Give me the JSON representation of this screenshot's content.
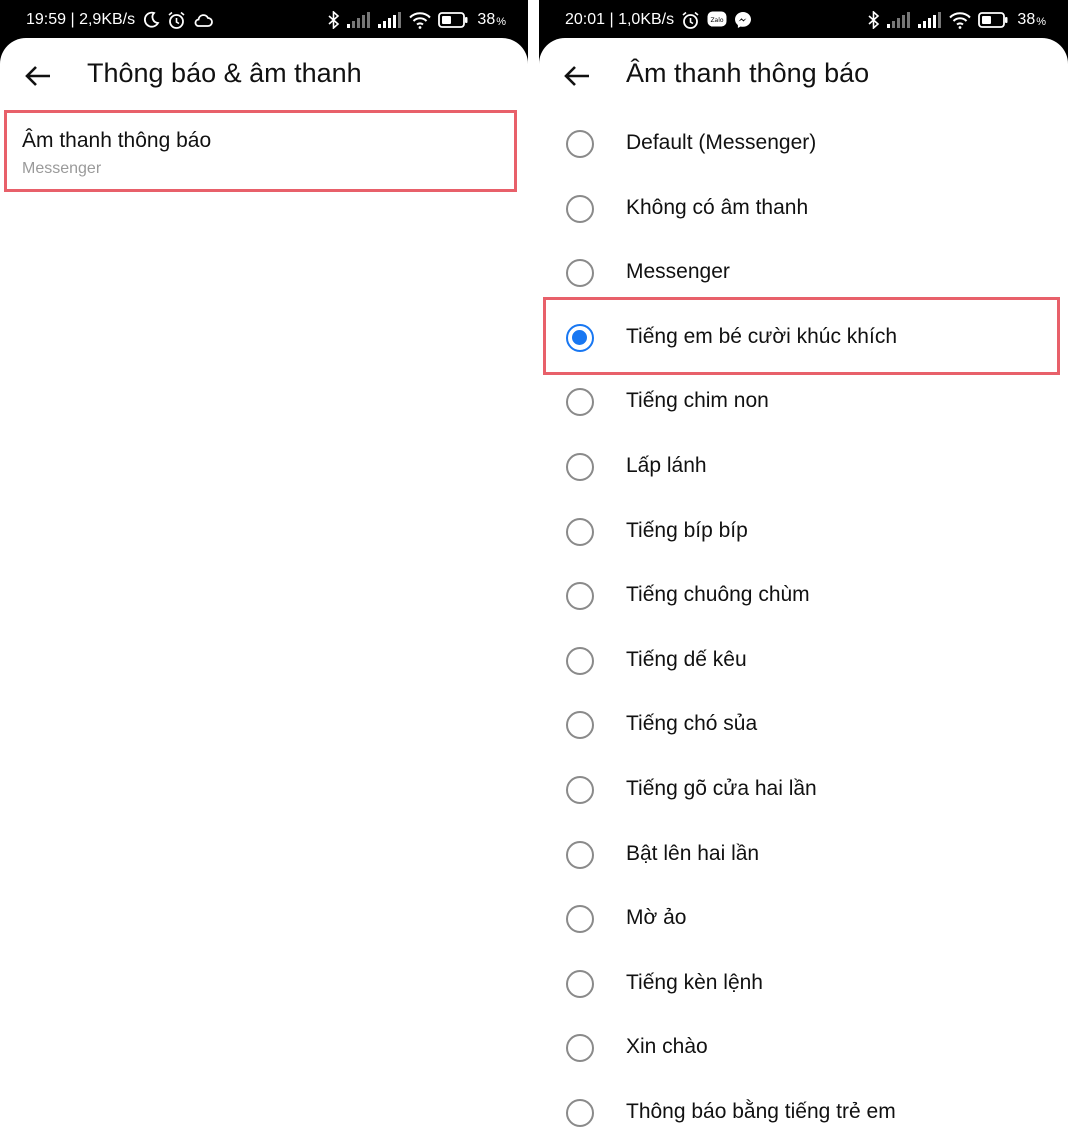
{
  "colors": {
    "accent": "#1877f2",
    "highlight": "#e8606a",
    "subtext": "#9a9a9a"
  },
  "left": {
    "status": {
      "time_speed": "19:59 | 2,9KB/s",
      "battery": "38"
    },
    "title": "Thông báo & âm thanh",
    "setting": {
      "title": "Âm thanh thông báo",
      "subtitle": "Messenger"
    }
  },
  "right": {
    "status": {
      "time_speed": "20:01 | 1,0KB/s",
      "battery": "38",
      "zalo_label": "Zalo"
    },
    "title": "Âm thanh thông báo",
    "selected_index": 3,
    "options": [
      "Default (Messenger)",
      "Không có âm thanh",
      "Messenger",
      "Tiếng em bé cười khúc khích",
      "Tiếng chim non",
      "Lấp lánh",
      "Tiếng bíp bíp",
      "Tiếng chuông chùm",
      "Tiếng dế kêu",
      "Tiếng chó sủa",
      "Tiếng gõ cửa hai lần",
      "Bật lên hai lần",
      "Mờ ảo",
      "Tiếng kèn lệnh",
      "Xin chào",
      "Thông báo bằng tiếng trẻ em"
    ]
  }
}
